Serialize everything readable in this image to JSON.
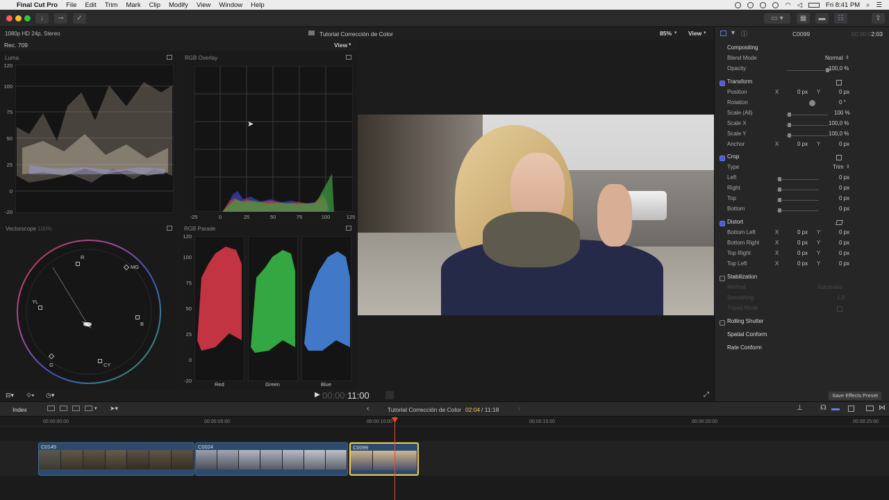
{
  "menubar": {
    "app": "Final Cut Pro",
    "items": [
      "File",
      "Edit",
      "Trim",
      "Mark",
      "Clip",
      "Modify",
      "View",
      "Window",
      "Help"
    ],
    "clock": "Fri 8:41 PM"
  },
  "viewer": {
    "format": "1080p HD 24p, Stereo",
    "title": "Tutorial Corrección de Color",
    "zoom": "85%",
    "view_label": "View",
    "timecode_dim": "00:00:",
    "timecode_bright": "11:00"
  },
  "scopes": {
    "colorspace": "Rec. 709",
    "view_label": "View",
    "luma": {
      "title": "Luma",
      "y_labels": [
        "120",
        "100",
        "75",
        "50",
        "25",
        "0",
        "-20"
      ]
    },
    "overlay": {
      "title": "RGB Overlay",
      "x_labels": [
        "-25",
        "0",
        "25",
        "50",
        "75",
        "100",
        "125"
      ]
    },
    "vectorscope": {
      "title": "Vectorscope",
      "pct": "100%",
      "targets": [
        "R",
        "MG",
        "B",
        "CY",
        "G",
        "YL"
      ]
    },
    "parade": {
      "title": "RGB Parade",
      "y_labels": [
        "120",
        "100",
        "75",
        "50",
        "25",
        "0",
        "-20"
      ],
      "channels": [
        "Red",
        "Green",
        "Blue"
      ]
    }
  },
  "inspector": {
    "clip": "C0099",
    "duration_dim": "00:00:0",
    "duration": "2:03",
    "compositing": "Compositing",
    "blend_mode_label": "Blend Mode",
    "blend_mode_value": "Normal",
    "opacity_label": "Opacity",
    "opacity_value": "100,0 %",
    "transform": "Transform",
    "position_label": "Position",
    "rotation_label": "Rotation",
    "rotation_value": "0 °",
    "scale_all_label": "Scale (All)",
    "scale_all_value": "100 %",
    "scale_x_label": "Scale X",
    "scale_x_value": "100,0 %",
    "scale_y_label": "Scale Y",
    "scale_y_value": "100,0 %",
    "anchor_label": "Anchor",
    "x": "X",
    "y": "Y",
    "zero_px": "0 px",
    "crop": "Crop",
    "type_label": "Type",
    "type_value": "Trim",
    "left_label": "Left",
    "right_label": "Right",
    "top_label": "Top",
    "bottom_label": "Bottom",
    "distort": "Distort",
    "bottom_left_label": "Bottom Left",
    "bottom_right_label": "Bottom Right",
    "top_right_label": "Top Right",
    "top_left_label": "Top Left",
    "stabilization": "Stabilization",
    "method_label": "Method",
    "method_value": "Automatic",
    "smoothing_label": "Smoothing",
    "smoothing_value": "1,0",
    "tripod_label": "Tripod Mode",
    "rolling_shutter": "Rolling Shutter",
    "spatial_conform": "Spatial Conform",
    "rate_conform": "Rate Conform",
    "save_preset": "Save Effects Preset"
  },
  "timeline": {
    "index_label": "Index",
    "project": "Tutorial Corrección de Color",
    "position": "02:04",
    "total": "/ 11:18",
    "ruler": [
      "00:00:00:00",
      "00:00:05:00",
      "00:00:10:00",
      "00:00:15:00",
      "00:00:20:00",
      "00:00:25:00"
    ],
    "clips": [
      {
        "name": "C0145"
      },
      {
        "name": "C0024"
      },
      {
        "name": "C0099"
      }
    ]
  },
  "colors": {
    "accent": "#4a5ad8",
    "selected_clip": "#f0d050",
    "playhead": "#e84a2a"
  }
}
